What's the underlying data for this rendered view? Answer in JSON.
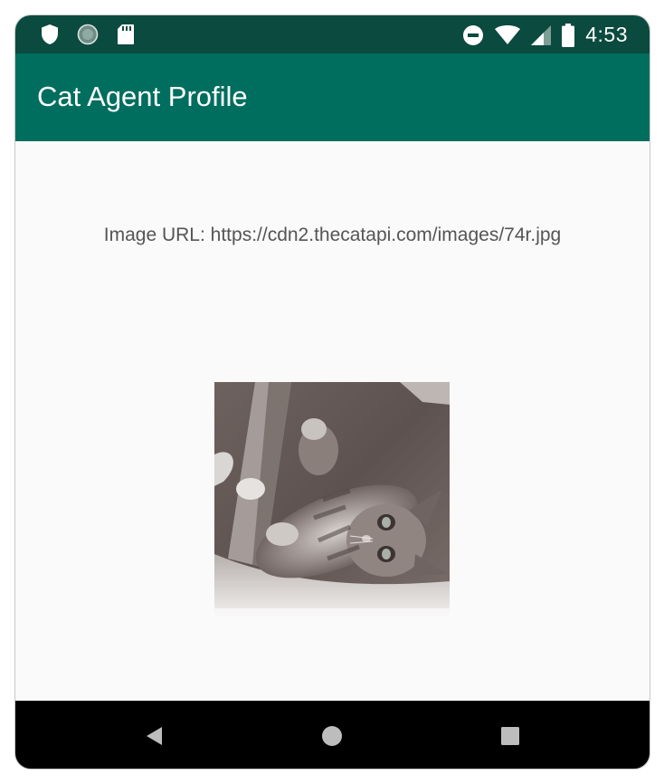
{
  "status_bar": {
    "time": "4:53",
    "left_icons": [
      "shield-icon",
      "circle-notification-icon",
      "sd-card-icon"
    ],
    "right_icons": [
      "do-not-disturb-icon",
      "wifi-icon",
      "signal-icon",
      "battery-icon"
    ]
  },
  "app_bar": {
    "title": "Cat Agent Profile",
    "color": "#006e5e"
  },
  "content": {
    "image_url_text": "Image URL: https://cdn2.thecatapi.com/images/74r.jpg"
  },
  "nav_bar": {
    "buttons": [
      "back-icon",
      "home-icon",
      "recents-icon"
    ]
  }
}
